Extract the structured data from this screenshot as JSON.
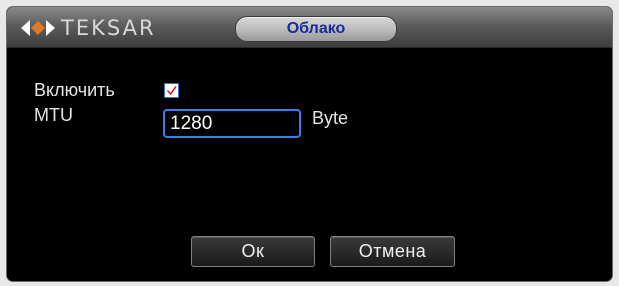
{
  "window": {
    "logo_text": "TEKSAR",
    "title": "Облако"
  },
  "form": {
    "enable_label": "Включить",
    "enable_checked": true,
    "mtu_label": "MTU",
    "mtu_value": "1280",
    "mtu_unit": "Byte"
  },
  "buttons": {
    "ok_label": "Ок",
    "cancel_label": "Отмена"
  },
  "colors": {
    "title_text": "#1a2a9a",
    "input_border": "#3d7fe0",
    "check_mark": "#e02020",
    "logo_accent": "#e07a2a"
  },
  "icons": {
    "logo_mark": "diamond-arrows-logo-icon",
    "checkbox_mark": "checkmark-icon"
  }
}
